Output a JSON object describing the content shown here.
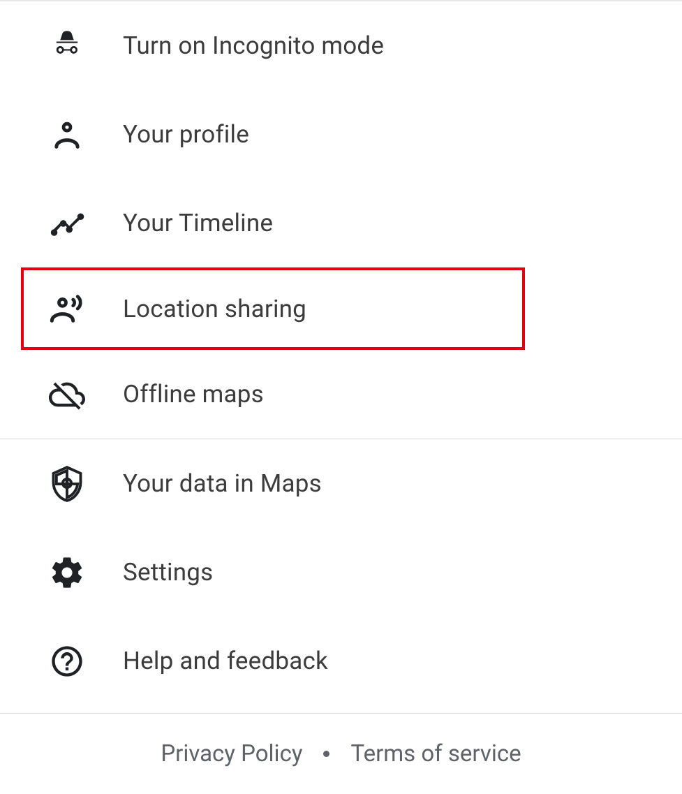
{
  "menu": {
    "items": [
      {
        "label": "Turn on Incognito mode",
        "icon": "incognito-icon"
      },
      {
        "label": "Your profile",
        "icon": "person-icon"
      },
      {
        "label": "Your Timeline",
        "icon": "timeline-icon"
      },
      {
        "label": "Location sharing",
        "icon": "location-sharing-icon",
        "highlighted": true
      },
      {
        "label": "Offline maps",
        "icon": "cloud-off-icon"
      },
      {
        "label": "Your data in Maps",
        "icon": "shield-icon"
      },
      {
        "label": "Settings",
        "icon": "gear-icon"
      },
      {
        "label": "Help and feedback",
        "icon": "help-icon"
      }
    ]
  },
  "footer": {
    "privacy": "Privacy Policy",
    "terms": "Terms of service"
  }
}
